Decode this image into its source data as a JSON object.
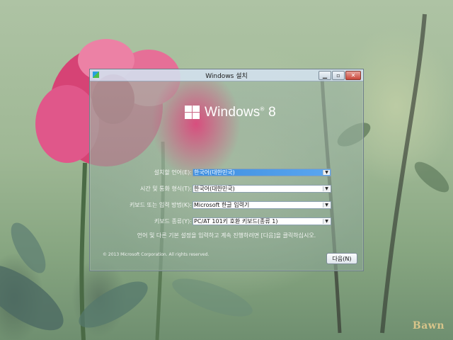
{
  "window": {
    "title": "Windows 설치"
  },
  "logo": {
    "text": "Windows",
    "version": "8"
  },
  "form": {
    "language": {
      "label": "설치할 언어(E):",
      "value": "한국어(대한민국)"
    },
    "time_currency": {
      "label": "시간 및 통화 형식(T):",
      "value": "한국어(대한민국)"
    },
    "keyboard_method": {
      "label": "키보드 또는 입력 방법(K):",
      "value": "Microsoft 한글 입력기"
    },
    "keyboard_type": {
      "label": "키보드 종류(Y):",
      "value": "PC/AT 101키 호환 키보드(종류 1)"
    }
  },
  "instruction": "언어 및 다른 기본 설정을 입력하고 계속 진행하려면 [다음]을 클릭하십시오.",
  "copyright": "© 2013 Microsoft Corporation. All rights reserved.",
  "buttons": {
    "next": "다음(N)"
  },
  "watermark": "Bawn",
  "colors": {
    "accent": "#3f8fe0",
    "rose": "#e23c78"
  }
}
